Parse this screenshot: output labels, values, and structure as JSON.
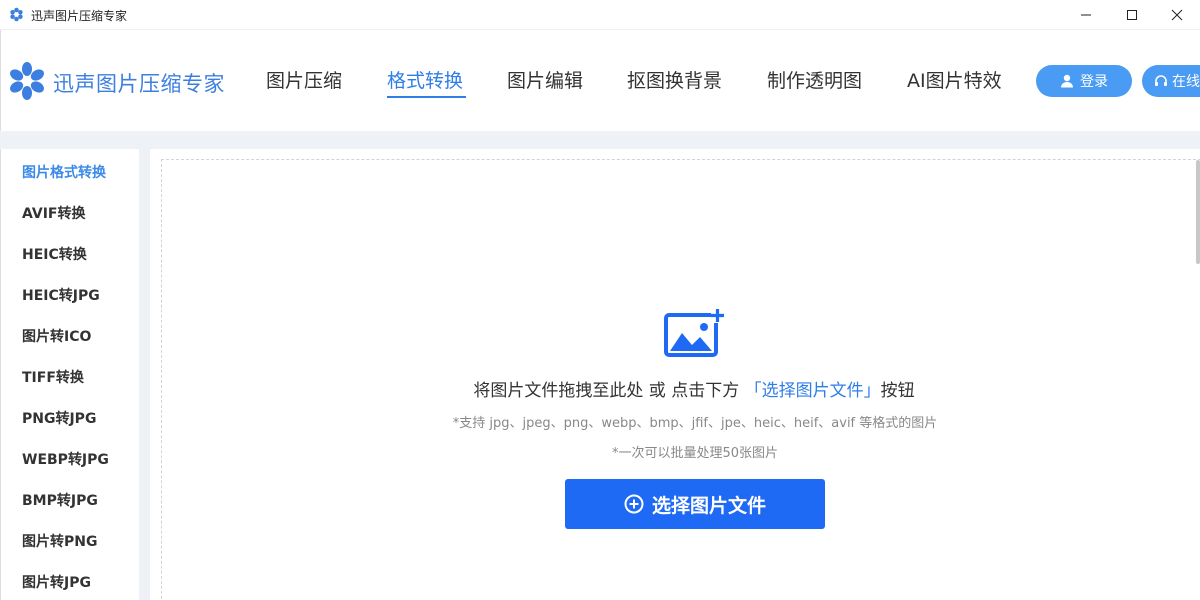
{
  "window": {
    "title": "迅声图片压缩专家",
    "controls": {
      "minimize_icon": "minimize-icon",
      "maximize_icon": "maximize-icon",
      "close_icon": "close-icon"
    }
  },
  "header": {
    "brand": "迅声图片压缩专家",
    "tabs": [
      {
        "label": "图片压缩"
      },
      {
        "label": "格式转换",
        "active": true
      },
      {
        "label": "图片编辑"
      },
      {
        "label": "抠图换背景"
      },
      {
        "label": "制作透明图"
      },
      {
        "label": "AI图片特效"
      }
    ],
    "login_label": "登录",
    "online_label": "在线"
  },
  "sidebar": {
    "items": [
      {
        "label": "图片格式转换",
        "active": true
      },
      {
        "label": "AVIF转换"
      },
      {
        "label": "HEIC转换"
      },
      {
        "label": "HEIC转JPG"
      },
      {
        "label": "图片转ICO"
      },
      {
        "label": "TIFF转换"
      },
      {
        "label": "PNG转JPG"
      },
      {
        "label": "WEBP转JPG"
      },
      {
        "label": "BMP转JPG"
      },
      {
        "label": "图片转PNG"
      },
      {
        "label": "图片转JPG"
      }
    ]
  },
  "main": {
    "drop_text_before": "将图片文件拖拽至此处 或 点击下方 ",
    "drop_text_highlight": "「选择图片文件」",
    "drop_text_after": "按钮",
    "support_text": "*支持 jpg、jpeg、png、webp、bmp、jfif、jpe、heic、heif、avif 等格式的图片",
    "batch_text": "*一次可以批量处理50张图片",
    "select_button_label": "选择图片文件"
  },
  "colors": {
    "accent": "#2f7ee8",
    "button": "#1f6af5",
    "pill": "#4a9bf3"
  }
}
